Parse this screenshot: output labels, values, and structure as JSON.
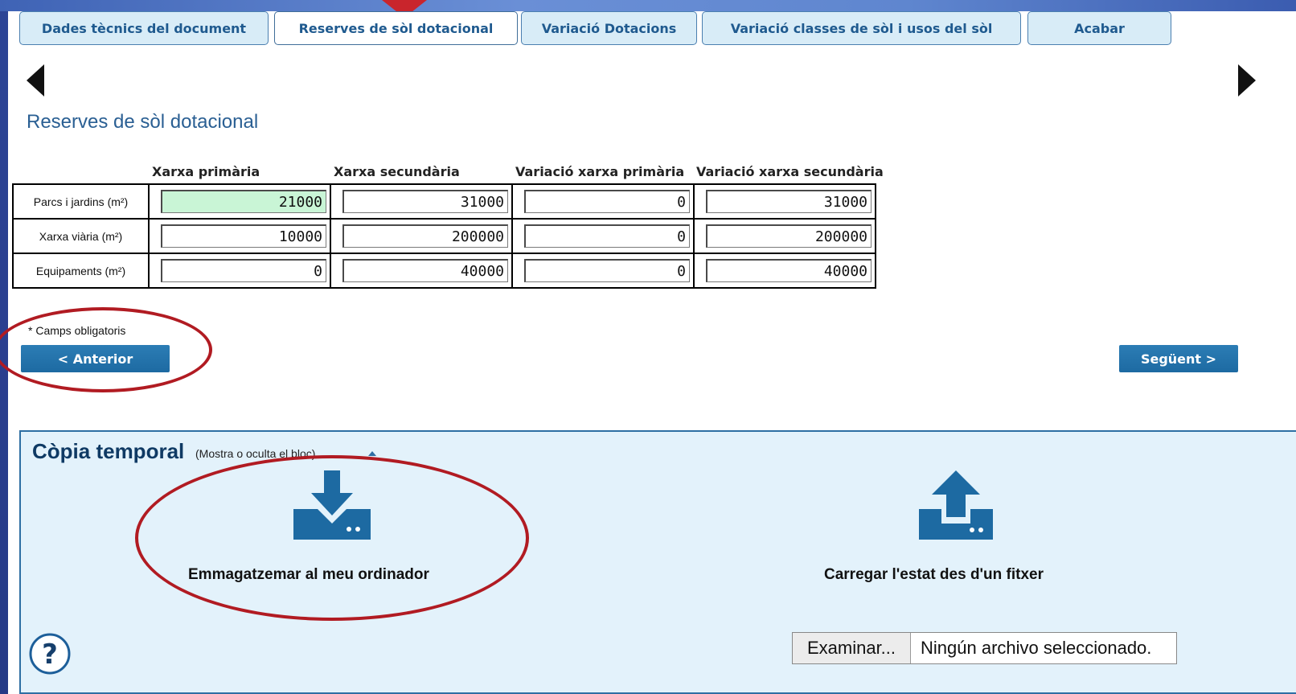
{
  "tabs": [
    {
      "label": "Dades tècnics del document"
    },
    {
      "label": "Reserves de sòl dotacional"
    },
    {
      "label": "Variació Dotacions"
    },
    {
      "label": "Variació classes de sòl i usos del sòl"
    },
    {
      "label": "Acabar"
    }
  ],
  "active_tab": "Reserves de sòl dotacional",
  "section_title": "Reserves de sòl dotacional",
  "table": {
    "columns": [
      "Xarxa primària",
      "Xarxa secundària",
      "Variació xarxa primària",
      "Variació xarxa secundària"
    ],
    "rows": [
      {
        "label": "Parcs i jardins (m²)",
        "values": [
          "21000",
          "31000",
          "0",
          "31000"
        ]
      },
      {
        "label": "Xarxa viària (m²)",
        "values": [
          "10000",
          "200000",
          "0",
          "200000"
        ]
      },
      {
        "label": "Equipaments (m²)",
        "values": [
          "0",
          "40000",
          "0",
          "40000"
        ]
      }
    ]
  },
  "mandatory_note": "* Camps obligatoris",
  "buttons": {
    "previous": "< Anterior",
    "next": "Següent >"
  },
  "copy_panel": {
    "title": "Còpia temporal",
    "toggle": "(Mostra o oculta el bloc)",
    "save_label": "Emmagatzemar al meu ordinador",
    "load_label": "Carregar l'estat des d'un fitxer",
    "file_button": "Examinar...",
    "file_status": "Ningún archivo seleccionado."
  },
  "colors": {
    "accent": "#1f5a8f",
    "highlight_cell": "#c9f5d6",
    "annotation": "#b11b22",
    "panel_bg": "#e3f2fb"
  }
}
